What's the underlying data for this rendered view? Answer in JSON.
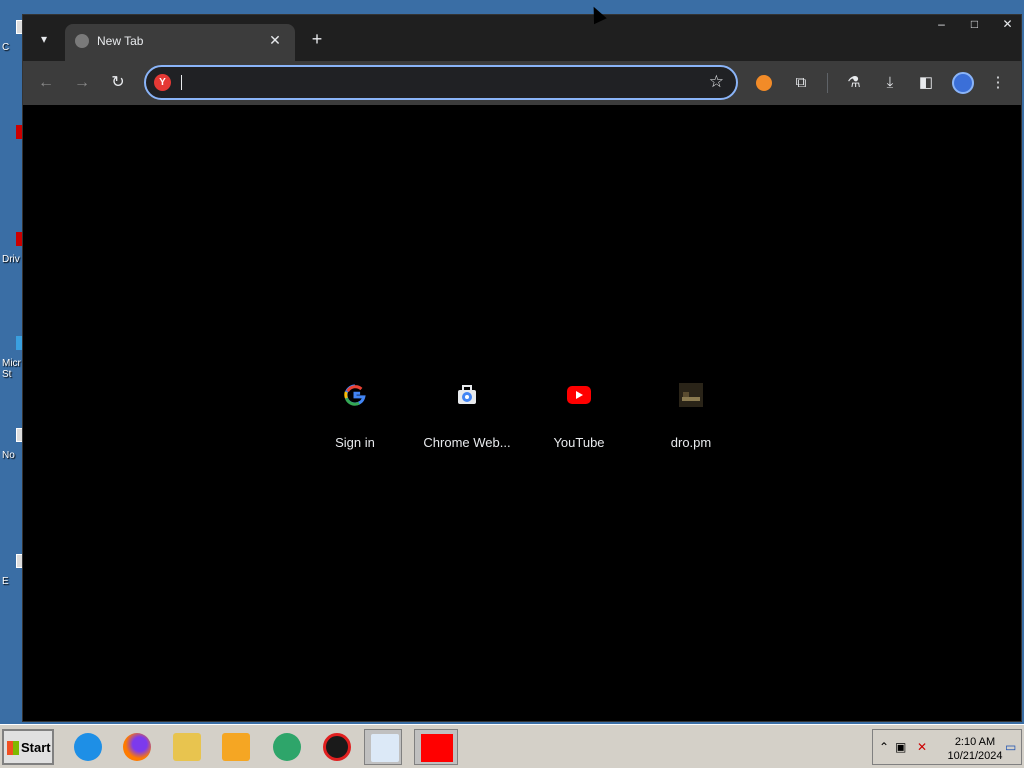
{
  "desktop": {
    "icons": [
      {
        "label": "C"
      },
      {
        "label": ""
      },
      {
        "label": "Driv"
      },
      {
        "label": "Micr St"
      },
      {
        "label": "No"
      },
      {
        "label": "E"
      }
    ]
  },
  "browser": {
    "tab": {
      "title": "New Tab"
    },
    "new_tab_symbol": "+",
    "window_controls": {
      "minimize": "–",
      "maximize": "□",
      "close": "✕"
    },
    "nav": {
      "back": "←",
      "forward": "→",
      "reload": "↻"
    },
    "omnibox": {
      "value": "",
      "placeholder": ""
    },
    "toolbar_icons": [
      "extensions-icon",
      "labs-icon",
      "download-icon",
      "side-panel-icon",
      "profile-icon",
      "menu-icon"
    ],
    "accent": "#8ab4f8"
  },
  "shortcuts": [
    {
      "label": "Sign in",
      "icon": "google-icon"
    },
    {
      "label": "Chrome Web...",
      "icon": "chrome-web-store-icon"
    },
    {
      "label": "YouTube",
      "icon": "youtube-icon"
    },
    {
      "label": "dro.pm",
      "icon": "dro-pm-icon"
    }
  ],
  "taskbar": {
    "start_label": "Start",
    "clock": {
      "time": "2:10 AM",
      "date": "10/21/2024"
    }
  }
}
